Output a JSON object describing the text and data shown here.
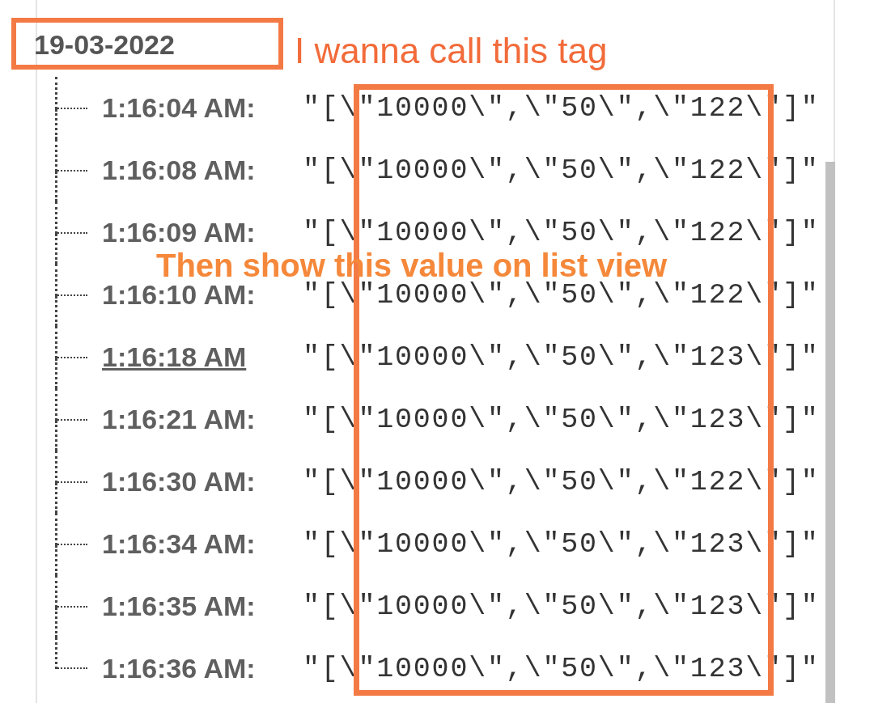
{
  "node": {
    "label": "19-03-2022",
    "children": [
      {
        "time": "1:16:04 AM:",
        "value": "\"[\\\"10000\\\",\\\"50\\\",\\\"122\\\"]\"",
        "hovered": false
      },
      {
        "time": "1:16:08 AM:",
        "value": "\"[\\\"10000\\\",\\\"50\\\",\\\"122\\\"]\"",
        "hovered": false
      },
      {
        "time": "1:16:09 AM:",
        "value": "\"[\\\"10000\\\",\\\"50\\\",\\\"122\\\"]\"",
        "hovered": false
      },
      {
        "time": "1:16:10 AM:",
        "value": "\"[\\\"10000\\\",\\\"50\\\",\\\"122\\\"]\"",
        "hovered": false
      },
      {
        "time": "1:16:18 AM",
        "value": "\"[\\\"10000\\\",\\\"50\\\",\\\"123\\\"]\"",
        "hovered": true
      },
      {
        "time": "1:16:21 AM:",
        "value": "\"[\\\"10000\\\",\\\"50\\\",\\\"123\\\"]\"",
        "hovered": false
      },
      {
        "time": "1:16:30 AM:",
        "value": "\"[\\\"10000\\\",\\\"50\\\",\\\"122\\\"]\"",
        "hovered": false
      },
      {
        "time": "1:16:34 AM:",
        "value": "\"[\\\"10000\\\",\\\"50\\\",\\\"123\\\"]\"",
        "hovered": false
      },
      {
        "time": "1:16:35 AM:",
        "value": "\"[\\\"10000\\\",\\\"50\\\",\\\"123\\\"]\"",
        "hovered": false
      },
      {
        "time": "1:16:36 AM:",
        "value": "\"[\\\"10000\\\",\\\"50\\\",\\\"123\\\"]\"",
        "hovered": false
      }
    ]
  },
  "annotations": [
    {
      "kind": "callout",
      "text": "I wanna call this tag"
    },
    {
      "kind": "overlay",
      "text": "Then show this value on list view"
    }
  ]
}
